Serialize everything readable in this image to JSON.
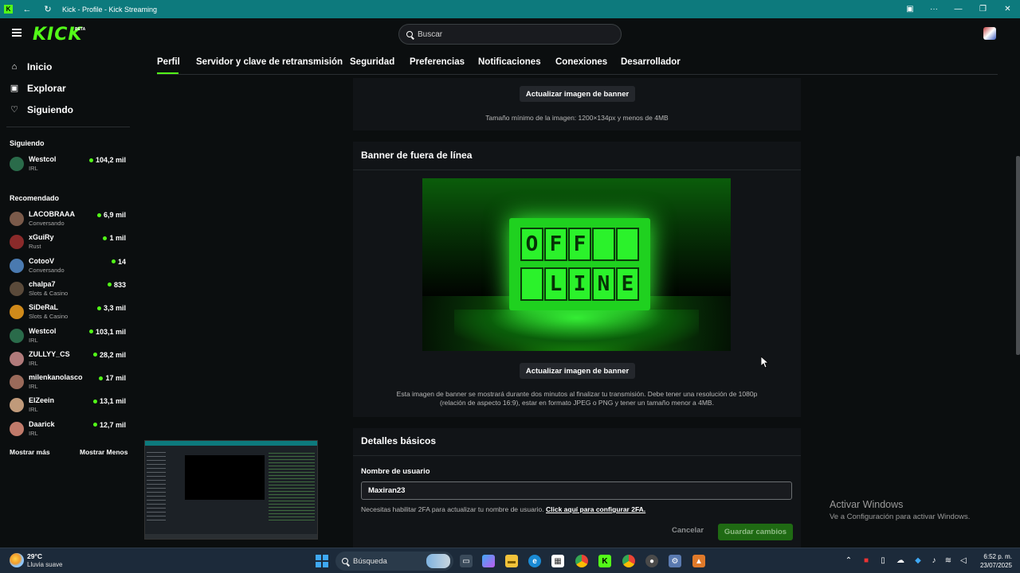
{
  "window": {
    "title": "Kick - Profile - Kick Streaming"
  },
  "header": {
    "logo": "KICK",
    "logo_badge": "BETA",
    "search_placeholder": "Buscar"
  },
  "sidebar": {
    "nav": [
      {
        "label": "Inicio",
        "icon": "home-icon"
      },
      {
        "label": "Explorar",
        "icon": "compass-icon"
      },
      {
        "label": "Siguiendo",
        "icon": "heart-icon"
      }
    ],
    "following_title": "Siguiendo",
    "following": [
      {
        "name": "Westcol",
        "category": "IRL",
        "viewers": "104,2 mil",
        "color": "#2a6b4a"
      }
    ],
    "recommended_title": "Recomendado",
    "recommended": [
      {
        "name": "LACOBRAAA",
        "category": "Conversando",
        "viewers": "6,9 mil",
        "color": "#7a5a4a"
      },
      {
        "name": "xGuiRy",
        "category": "Rust",
        "viewers": "1 mil",
        "color": "#8a2a2a"
      },
      {
        "name": "CotooV",
        "category": "Conversando",
        "viewers": "14",
        "color": "#4a7ab0"
      },
      {
        "name": "chalpa7",
        "category": "Slots & Casino",
        "viewers": "833",
        "color": "#5a4a3a"
      },
      {
        "name": "SiDeRaL",
        "category": "Slots & Casino",
        "viewers": "3,3 mil",
        "color": "#d08a1a"
      },
      {
        "name": "Westcol",
        "category": "IRL",
        "viewers": "103,1 mil",
        "color": "#2a6b4a"
      },
      {
        "name": "ZULLYY_CS",
        "category": "IRL",
        "viewers": "28,2 mil",
        "color": "#b07a7a"
      },
      {
        "name": "milenkanolasco",
        "category": "IRL",
        "viewers": "17 mil",
        "color": "#9a6a5a"
      },
      {
        "name": "ElZeein",
        "category": "IRL",
        "viewers": "13,1 mil",
        "color": "#c09a7a"
      },
      {
        "name": "Daarick",
        "category": "IRL",
        "viewers": "12,7 mil",
        "color": "#c07a6a"
      }
    ],
    "show_more": "Mostrar más",
    "show_less": "Mostrar Menos"
  },
  "tabs": [
    "Perfil",
    "Servidor y clave de retransmisión",
    "Seguridad",
    "Preferencias",
    "Notificaciones",
    "Conexiones",
    "Desarrollador"
  ],
  "banner_section": {
    "button": "Actualizar imagen de banner",
    "helper": "Tamaño mínimo de la imagen: 1200×134px y menos de 4MB"
  },
  "offline_section": {
    "title": "Banner de fuera de línea",
    "image_row1": [
      "O",
      "F",
      "F",
      ""
    ],
    "image_row2": [
      "",
      "L",
      "I",
      "N",
      "E"
    ],
    "button": "Actualizar imagen de banner",
    "helper_line1": "Esta imagen de banner se mostrará durante dos minutos al finalizar tu transmisión. Debe tener una resolución de 1080p",
    "helper_line2": "(relación de aspecto 16:9), estar en formato JPEG o PNG y tener un tamaño menor a 4MB."
  },
  "basic_details": {
    "title": "Detalles básicos",
    "username_label": "Nombre de usuario",
    "username_value": "Maxiran23",
    "note_text": "Necesitas habilitar 2FA para actualizar tu nombre de usuario.",
    "note_link": "Click aquí para configurar 2FA.",
    "cancel": "Cancelar",
    "save": "Guardar cambios"
  },
  "watermark": {
    "line1": "Activar Windows",
    "line2": "Ve a Configuración para activar Windows."
  },
  "taskbar": {
    "temp": "29°C",
    "weather": "Lluvia suave",
    "search": "Búsqueda",
    "time": "6:52 p. m.",
    "date": "23/07/2025"
  },
  "colors": {
    "brand": "#53fc18",
    "titlebar": "#0d7a7d",
    "background": "#0b0e0f"
  }
}
